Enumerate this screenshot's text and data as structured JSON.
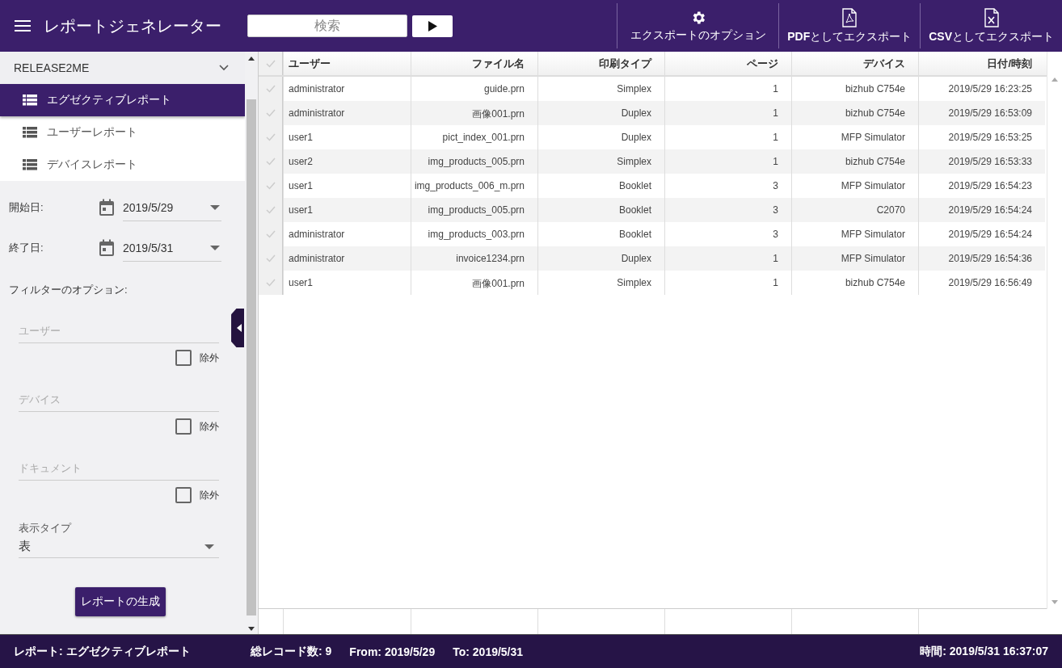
{
  "header": {
    "title": "レポートジェネレーター",
    "search": {
      "placeholder": "検索"
    },
    "actions": [
      {
        "kind": "gear",
        "label": "エクスポートのオプション"
      },
      {
        "kind": "pdf",
        "label": "**PDF**としてエクスポート"
      },
      {
        "kind": "csv",
        "label": "**CSV**としてエクスポート"
      }
    ]
  },
  "sidebar": {
    "group": {
      "label": "RELEASE2ME",
      "expanded": true
    },
    "reports": [
      {
        "label": "エグゼクティブレポート",
        "selected": true
      },
      {
        "label": "ユーザーレポート",
        "selected": false
      },
      {
        "label": "デバイスレポート",
        "selected": false
      }
    ],
    "dates": [
      {
        "label": "開始日:",
        "value": "2019/5/29"
      },
      {
        "label": "終了日:",
        "value": "2019/5/31"
      }
    ],
    "filter_heading": "フィルターのオプション:",
    "filters": [
      {
        "placeholder": "ユーザー",
        "exclude_label": "除外",
        "checked": false
      },
      {
        "placeholder": "デバイス",
        "exclude_label": "除外",
        "checked": false
      },
      {
        "placeholder": "ドキュメント",
        "exclude_label": "除外",
        "checked": false
      }
    ],
    "display_type": {
      "label": "表示タイプ",
      "value": "表"
    },
    "generate_button": "レポートの生成"
  },
  "table": {
    "columns": [
      "ユーザー",
      "ファイル名",
      "印刷タイプ",
      "ページ",
      "デバイス",
      "日付/時刻"
    ],
    "rows": [
      {
        "selected": false,
        "cells": [
          "administrator",
          "guide.prn",
          "Simplex",
          "1",
          "bizhub C754e",
          "2019/5/29 16:23:25"
        ]
      },
      {
        "selected": false,
        "cells": [
          "administrator",
          "画像001.prn",
          "Duplex",
          "1",
          "bizhub C754e",
          "2019/5/29 16:53:09"
        ]
      },
      {
        "selected": false,
        "cells": [
          "user1",
          "pict_index_001.prn",
          "Duplex",
          "1",
          "MFP Simulator",
          "2019/5/29 16:53:25"
        ]
      },
      {
        "selected": false,
        "cells": [
          "user2",
          "img_products_005.prn",
          "Simplex",
          "1",
          "bizhub C754e",
          "2019/5/29 16:53:33"
        ]
      },
      {
        "selected": false,
        "cells": [
          "user1",
          "img_products_006_m.prn",
          "Booklet",
          "3",
          "MFP Simulator",
          "2019/5/29 16:54:23"
        ]
      },
      {
        "selected": false,
        "cells": [
          "user1",
          "img_products_005.prn",
          "Booklet",
          "3",
          "C2070",
          "2019/5/29 16:54:24"
        ]
      },
      {
        "selected": false,
        "cells": [
          "administrator",
          "img_products_003.prn",
          "Booklet",
          "3",
          "MFP Simulator",
          "2019/5/29 16:54:24"
        ]
      },
      {
        "selected": false,
        "cells": [
          "administrator",
          "invoice1234.prn",
          "Duplex",
          "1",
          "MFP Simulator",
          "2019/5/29 16:54:36"
        ]
      },
      {
        "selected": false,
        "cells": [
          "user1",
          "画像001.prn",
          "Simplex",
          "1",
          "bizhub C754e",
          "2019/5/29 16:56:49"
        ]
      }
    ]
  },
  "status_bar": {
    "report": "レポート: エグゼクティブレポート",
    "total": "総レコード数: 9",
    "from": "From: 2019/5/29",
    "to": "To: 2019/5/31",
    "time": "時間: 2019/5/31 16:37:07"
  }
}
